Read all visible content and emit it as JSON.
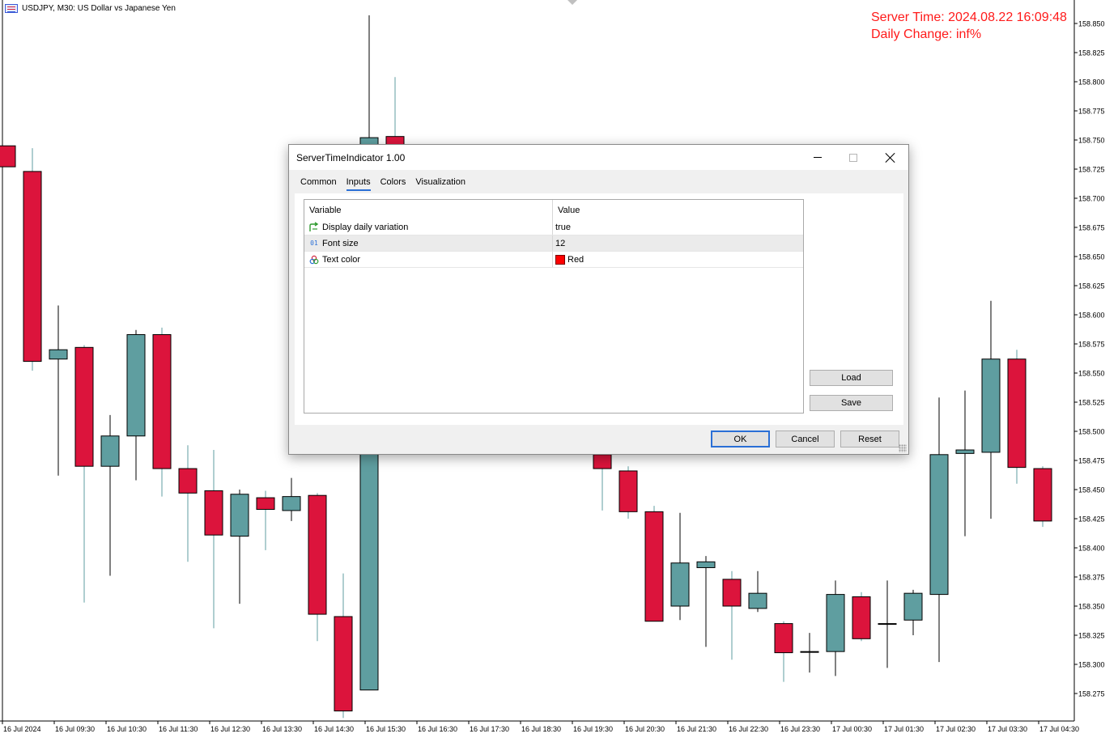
{
  "window": {
    "symbol_title": "USDJPY, M30:  US Dollar vs Japanese Yen"
  },
  "overlay": {
    "server_time": "Server Time: 2024.08.22 16:09:48",
    "daily_change": "Daily Change: inf%"
  },
  "colors": {
    "bull": "#5f9ea0",
    "bear": "#dc143c",
    "server_text": "#ff1a1a",
    "axis_text": "#000000"
  },
  "dialog": {
    "title": "ServerTimeIndicator 1.00",
    "tabs": [
      "Common",
      "Inputs",
      "Colors",
      "Visualization"
    ],
    "active_tab": "Inputs",
    "grid_headers": {
      "variable": "Variable",
      "value": "Value"
    },
    "rows": [
      {
        "icon": "bool-arrow-icon",
        "variable": "Display daily variation",
        "value": "true"
      },
      {
        "icon": "number-icon",
        "variable": "Font size",
        "value": "12"
      },
      {
        "icon": "color-palette-icon",
        "variable": "Text color",
        "value": "Red",
        "swatch": "#ff0000"
      }
    ],
    "buttons": {
      "load": "Load",
      "save": "Save",
      "ok": "OK",
      "cancel": "Cancel",
      "reset": "Reset"
    }
  },
  "chart_data": {
    "type": "candlestick",
    "symbol": "USDJPY",
    "timeframe": "M30",
    "ylim": [
      158.25,
      158.87
    ],
    "y_ticks": [
      "158.850",
      "158.825",
      "158.800",
      "158.775",
      "158.750",
      "158.725",
      "158.700",
      "158.675",
      "158.650",
      "158.625",
      "158.600",
      "158.575",
      "158.550",
      "158.525",
      "158.500",
      "158.475",
      "158.450",
      "158.425",
      "158.400",
      "158.375",
      "158.350",
      "158.325",
      "158.300",
      "158.275"
    ],
    "x_ticks": [
      "16 Jul 2024",
      "16 Jul 09:30",
      "16 Jul 10:30",
      "16 Jul 11:30",
      "16 Jul 12:30",
      "16 Jul 13:30",
      "16 Jul 14:30",
      "16 Jul 15:30",
      "16 Jul 16:30",
      "16 Jul 17:30",
      "16 Jul 18:30",
      "16 Jul 19:30",
      "16 Jul 20:30",
      "16 Jul 21:30",
      "16 Jul 22:30",
      "16 Jul 23:30",
      "17 Jul 00:30",
      "17 Jul 01:30",
      "17 Jul 02:30",
      "17 Jul 03:30",
      "17 Jul 04:30"
    ],
    "candles": [
      {
        "x": "16 Jul 08:30",
        "o": 158.745,
        "h": 158.745,
        "l": 158.727,
        "c": 158.727
      },
      {
        "x": "16 Jul 09:00",
        "o": 158.723,
        "h": 158.743,
        "l": 158.552,
        "c": 158.56
      },
      {
        "x": "16 Jul 09:30",
        "o": 158.562,
        "h": 158.608,
        "l": 158.462,
        "c": 158.57
      },
      {
        "x": "16 Jul 10:00",
        "o": 158.572,
        "h": 158.574,
        "l": 158.353,
        "c": 158.47
      },
      {
        "x": "16 Jul 10:30",
        "o": 158.47,
        "h": 158.514,
        "l": 158.376,
        "c": 158.496
      },
      {
        "x": "16 Jul 11:00",
        "o": 158.496,
        "h": 158.587,
        "l": 158.458,
        "c": 158.583
      },
      {
        "x": "16 Jul 11:30",
        "o": 158.583,
        "h": 158.589,
        "l": 158.444,
        "c": 158.468
      },
      {
        "x": "16 Jul 12:00",
        "o": 158.468,
        "h": 158.488,
        "l": 158.388,
        "c": 158.447
      },
      {
        "x": "16 Jul 12:30",
        "o": 158.449,
        "h": 158.484,
        "l": 158.331,
        "c": 158.411
      },
      {
        "x": "16 Jul 13:00",
        "o": 158.41,
        "h": 158.45,
        "l": 158.352,
        "c": 158.446
      },
      {
        "x": "16 Jul 13:30",
        "o": 158.443,
        "h": 158.449,
        "l": 158.398,
        "c": 158.433
      },
      {
        "x": "16 Jul 14:00",
        "o": 158.432,
        "h": 158.46,
        "l": 158.423,
        "c": 158.444
      },
      {
        "x": "16 Jul 14:30",
        "o": 158.445,
        "h": 158.447,
        "l": 158.32,
        "c": 158.343
      },
      {
        "x": "16 Jul 15:00",
        "o": 158.341,
        "h": 158.378,
        "l": 158.254,
        "c": 158.26
      },
      {
        "x": "16 Jul 15:30",
        "o": 158.278,
        "h": 158.857,
        "l": 158.278,
        "c": 158.752
      },
      {
        "x": "16 Jul 16:00",
        "o": 158.753,
        "h": 158.804,
        "l": 158.745,
        "c": 158.745
      },
      {
        "x": "16 Jul 20:00",
        "o": 158.48,
        "h": 158.484,
        "l": 158.432,
        "c": 158.468
      },
      {
        "x": "16 Jul 20:30",
        "o": 158.466,
        "h": 158.47,
        "l": 158.425,
        "c": 158.431
      },
      {
        "x": "16 Jul 21:00",
        "o": 158.431,
        "h": 158.436,
        "l": 158.337,
        "c": 158.337
      },
      {
        "x": "16 Jul 21:30",
        "o": 158.35,
        "h": 158.43,
        "l": 158.338,
        "c": 158.387
      },
      {
        "x": "16 Jul 22:00",
        "o": 158.383,
        "h": 158.393,
        "l": 158.315,
        "c": 158.388
      },
      {
        "x": "16 Jul 22:30",
        "o": 158.373,
        "h": 158.38,
        "l": 158.304,
        "c": 158.35
      },
      {
        "x": "16 Jul 23:00",
        "o": 158.348,
        "h": 158.38,
        "l": 158.345,
        "c": 158.361
      },
      {
        "x": "16 Jul 23:30",
        "o": 158.335,
        "h": 158.337,
        "l": 158.285,
        "c": 158.31
      },
      {
        "x": "17 Jul 00:00",
        "o": 158.311,
        "h": 158.327,
        "l": 158.293,
        "c": 158.311
      },
      {
        "x": "17 Jul 00:30",
        "o": 158.311,
        "h": 158.372,
        "l": 158.29,
        "c": 158.36
      },
      {
        "x": "17 Jul 01:00",
        "o": 158.358,
        "h": 158.362,
        "l": 158.32,
        "c": 158.322
      },
      {
        "x": "17 Jul 01:30",
        "o": 158.335,
        "h": 158.372,
        "l": 158.297,
        "c": 158.335
      },
      {
        "x": "17 Jul 02:00",
        "o": 158.338,
        "h": 158.364,
        "l": 158.325,
        "c": 158.361
      },
      {
        "x": "17 Jul 02:30",
        "o": 158.36,
        "h": 158.529,
        "l": 158.302,
        "c": 158.48
      },
      {
        "x": "17 Jul 03:00",
        "o": 158.481,
        "h": 158.535,
        "l": 158.41,
        "c": 158.484
      },
      {
        "x": "17 Jul 03:30",
        "o": 158.482,
        "h": 158.612,
        "l": 158.425,
        "c": 158.562
      },
      {
        "x": "17 Jul 04:00",
        "o": 158.562,
        "h": 158.57,
        "l": 158.455,
        "c": 158.469
      },
      {
        "x": "17 Jul 04:30",
        "o": 158.468,
        "h": 158.47,
        "l": 158.418,
        "c": 158.423
      }
    ]
  }
}
